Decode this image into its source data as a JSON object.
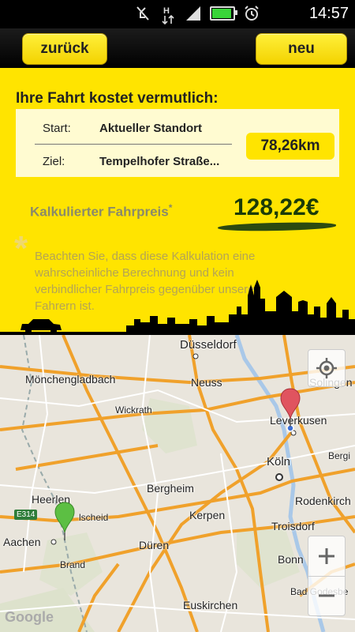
{
  "status_bar": {
    "time": "14:57",
    "icons": [
      "mute-icon",
      "data-arrows-icon",
      "signal-icon",
      "battery-icon",
      "alarm-icon"
    ]
  },
  "nav": {
    "back_label": "zurück",
    "new_label": "neu"
  },
  "trip": {
    "heading": "Ihre Fahrt kostet vermutlich:",
    "start_label": "Start:",
    "start_value": "Aktueller Standort",
    "dest_label": "Ziel:",
    "dest_value": "Tempelhofer Straße...",
    "distance": "78,26km",
    "fare_label": "Kalkulierter Fahrpreis",
    "fare_star": "*",
    "fare_value": "128,22€",
    "disclaimer_star": "*",
    "disclaimer": "Beachten Sie, dass diese Kalkulation eine wahrscheinliche Berechnung und kein verbindlicher Fahrpreis gegenüber unseren Fahrern ist."
  },
  "map": {
    "cities": {
      "duesseldorf": "Düsseldorf",
      "moenchengladbach": "Mönchengladbach",
      "neuss": "Neuss",
      "solingen": "Solingen",
      "wickrath": "Wickrath",
      "leverkusen": "Leverkusen",
      "koeln": "Köln",
      "bergisch": "Bergi",
      "bergheim": "Bergheim",
      "heerlen": "Heerlen",
      "kerkrade": "lscheid",
      "rodenkirchen": "Rodenkirch",
      "kerpen": "Kerpen",
      "troisdorf": "Troisdorf",
      "aachen": "Aachen",
      "dueren": "Düren",
      "bonn": "Bonn",
      "brand": "Brand",
      "badgodesberg": "Bad Godesbe",
      "euskirchen": "Euskirchen"
    },
    "road_badge": "E314",
    "attribution": "Google",
    "colors": {
      "highway": "#f0a12b",
      "road": "#ffffff",
      "water": "#a9c8e8",
      "start_pin": "#5cbf43",
      "dest_pin": "#e0545f"
    }
  },
  "colors": {
    "panel": "#ffe400",
    "button": "#f7df12",
    "fare": "#1b3b08"
  }
}
